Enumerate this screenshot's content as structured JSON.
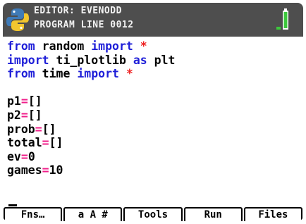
{
  "header": {
    "line1": "EDITOR: EVENODD",
    "line2": "PROGRAM LINE 0012"
  },
  "colors": {
    "keyword": "#1e1ed8",
    "operator": "#f01e8a",
    "star": "#ee2020",
    "titlebar": "#4e4e4e",
    "battery": "#3cc83c"
  },
  "code": {
    "l1": {
      "kw1": "from",
      "t1": " random ",
      "kw2": "import",
      "star": "*"
    },
    "l2": {
      "kw1": "import",
      "t1": " ti_plotlib ",
      "kw2": "as",
      "t2": " plt"
    },
    "l3": {
      "kw1": "from",
      "t1": " time ",
      "kw2": "import",
      "star": "*"
    },
    "l5": {
      "name": "p1",
      "op": "=",
      "val": "[]"
    },
    "l6": {
      "name": "p2",
      "op": "=",
      "val": "[]"
    },
    "l7": {
      "name": "prob",
      "op": "=",
      "val": "[]"
    },
    "l8": {
      "name": "total",
      "op": "=",
      "val": "[]"
    },
    "l9": {
      "name": "ev",
      "op": "=",
      "val": "0"
    },
    "l10": {
      "name": "games",
      "op": "=",
      "val": "10"
    }
  },
  "softkeys": [
    "Fns…",
    "a A #",
    "Tools",
    "Run",
    "Files"
  ],
  "icons": [
    "python-logo-icon",
    "battery-icon"
  ]
}
